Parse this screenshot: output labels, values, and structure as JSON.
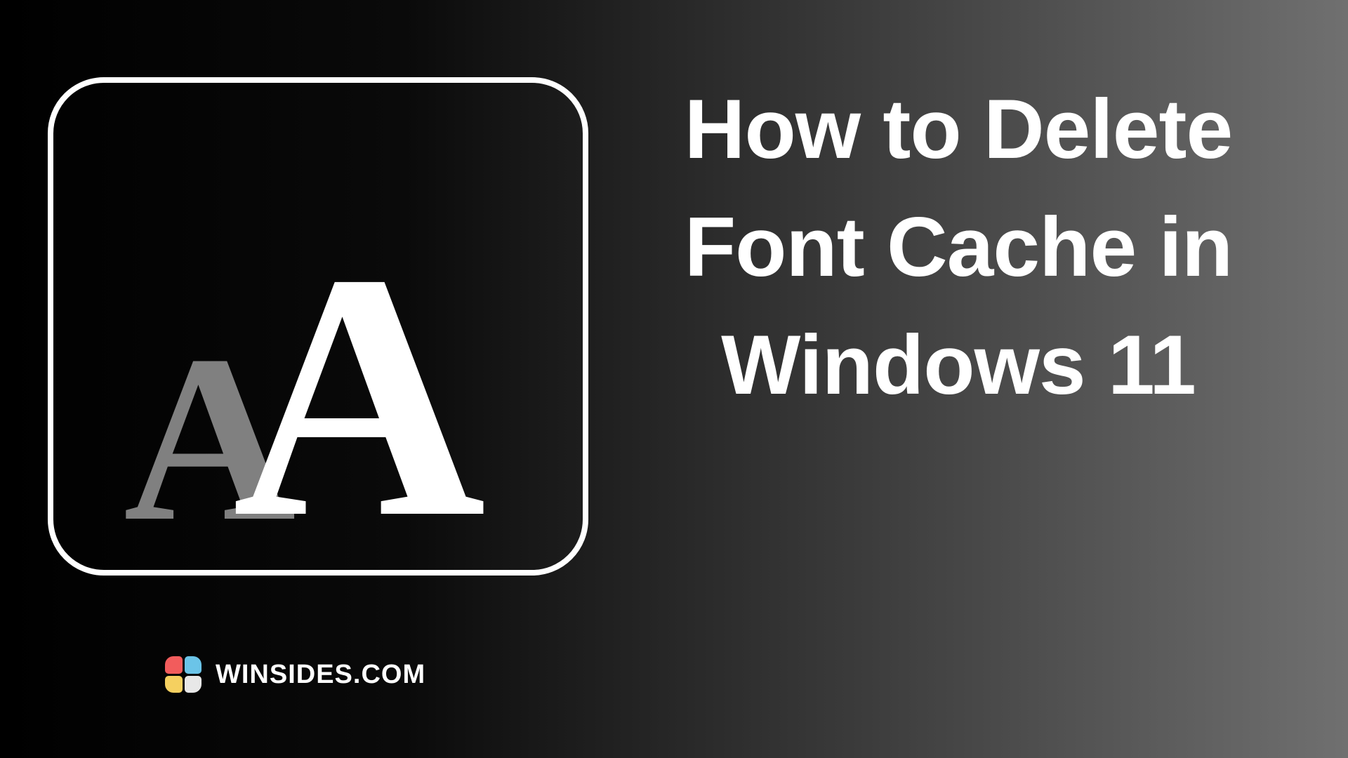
{
  "headline": "How to Delete Font Cache in Windows 11",
  "icon": {
    "letter_small": "A",
    "letter_large": "A"
  },
  "brand": {
    "text": "WINSIDES.COM",
    "colors": {
      "top_left": "#f25c5c",
      "top_right": "#6bc4e8",
      "bottom_left": "#f5d060",
      "bottom_right": "#e8e8e8"
    }
  }
}
